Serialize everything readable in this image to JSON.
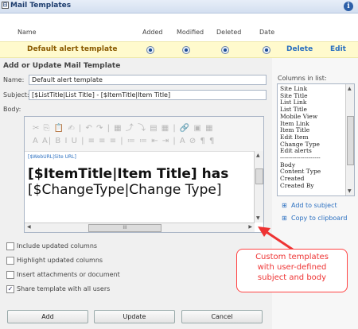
{
  "panel": {
    "title": "Mail Templates",
    "collapse_glyph": "⊟",
    "info_glyph": "i"
  },
  "table": {
    "headers": {
      "name": "Name",
      "added": "Added",
      "modified": "Modified",
      "deleted": "Deleted",
      "date": "Date"
    },
    "row": {
      "name": "Default alert template",
      "delete": "Delete",
      "edit": "Edit"
    }
  },
  "form": {
    "heading": "Add or Update Mail Template",
    "name_label": "Name:",
    "name_value": "Default alert template",
    "subject_label": "Subject:",
    "subject_value": "[$ListTitle|List Title] - [$ItemTitle|Item Title]",
    "body_label": "Body:",
    "toolbar_row1": "✂ ⎘ 📋 ✍ | ↶ ↷ | ▦ ⤴ ⤵ ▤ ▦ | 🔗 ▣ ▦",
    "toolbar_row2": "A A| B I U | ≡ ≡ ≡ | ≔ ≔ ⇤ ⇥ | A ⊘ ¶ ¶",
    "body_link": "[$WebURL|Site URL]",
    "body_line1": "[$ItemTitle|Item Title] has",
    "body_line2": "[$ChangeType|Change Type]",
    "hscroll_glyph": "III"
  },
  "options": [
    {
      "label": "Include updated columns",
      "checked": false
    },
    {
      "label": "Highlight updated columns",
      "checked": false
    },
    {
      "label": "Insert attachments or document",
      "checked": false
    },
    {
      "label": "Share template with all users",
      "checked": true
    }
  ],
  "buttons": {
    "add": "Add",
    "update": "Update",
    "cancel": "Cancel"
  },
  "columns_panel": {
    "title": "Columns in list:",
    "items": [
      "Site Link",
      "Site Title",
      "List Link",
      "List Title",
      "Mobile View",
      "Item Link",
      "Item Title",
      "Edit Item",
      "Change Type",
      "Edit alerts",
      "--------------------",
      "Body",
      "Content Type",
      "Created",
      "Created By"
    ],
    "add_to_subject": "Add to subject",
    "copy_to_clipboard": "Copy to clipboard"
  },
  "callout": {
    "line1": "Custom templates",
    "line2": "with user-defined",
    "line3": "subject and body"
  },
  "colors": {
    "accent": "#2a6fc0",
    "highlight_row": "#fffacd",
    "callout": "#e33333"
  }
}
